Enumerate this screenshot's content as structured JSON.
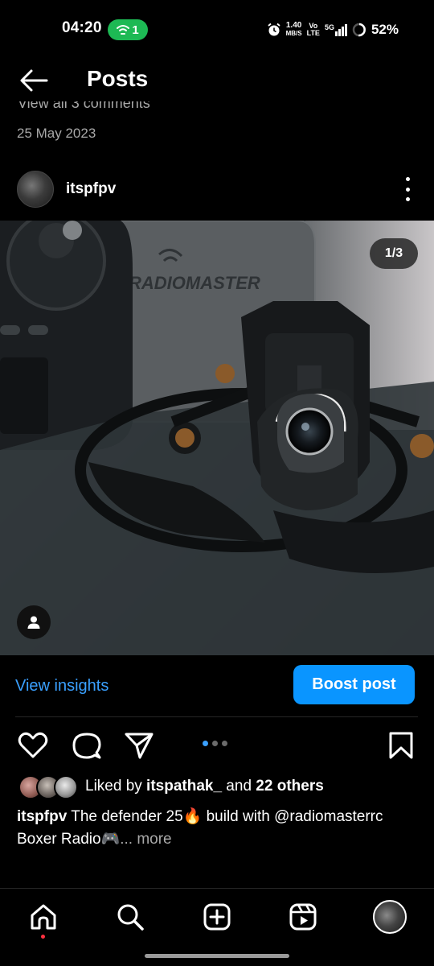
{
  "status_bar": {
    "time": "04:20",
    "hotspot_count": "1",
    "speed_value": "1.40",
    "speed_unit": "MB/S",
    "net_top": "Vo",
    "net_bottom": "LTE",
    "signal_type": "5G",
    "battery": "52%"
  },
  "header": {
    "title": "Posts"
  },
  "previous_post": {
    "cut_text": "View all 3 comments",
    "date": "25 May 2023"
  },
  "post": {
    "username": "itspfpv",
    "image_counter": "1/3",
    "photo_brand_text": "RADIOMASTER",
    "view_insights_label": "View insights",
    "boost_label": "Boost post",
    "carousel": {
      "pages": 3,
      "current": 1
    },
    "likes": {
      "prefix": "Liked by ",
      "user": "itspathak_",
      "middle": " and ",
      "others": "22 others"
    },
    "caption": {
      "user": "itspfpv",
      "text": " The defender 25🔥 build with @radiomasterrc Boxer Radio🎮",
      "more": "... more"
    }
  },
  "bottom_nav": {
    "items": [
      "home-icon",
      "search-icon",
      "create-icon",
      "reels-icon",
      "profile-avatar"
    ]
  },
  "colors": {
    "accent": "#0a95ff",
    "link": "#3aa0ff",
    "hotspot": "#1db954",
    "notification": "#ff3040"
  }
}
